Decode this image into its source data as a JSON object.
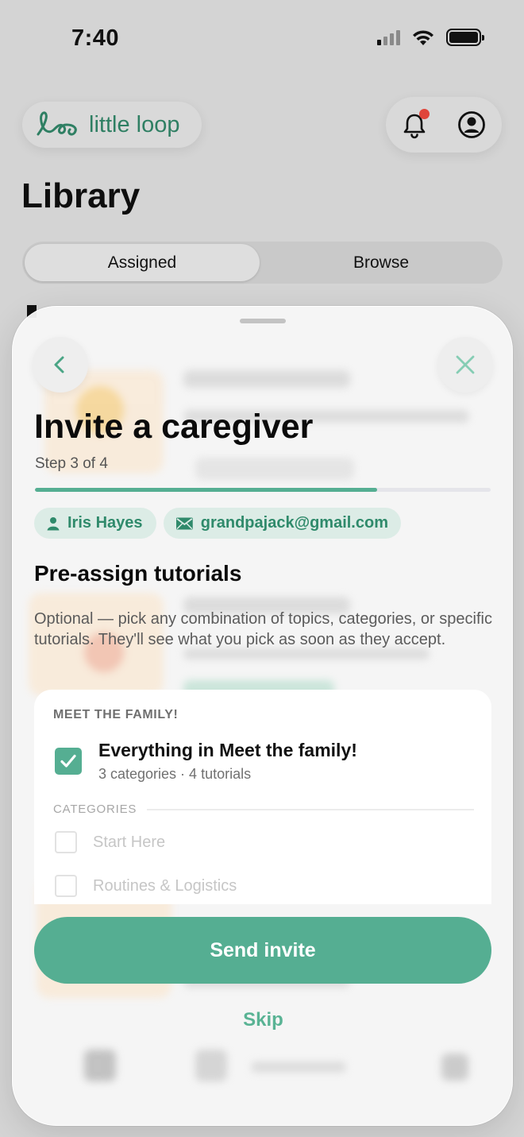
{
  "status_bar": {
    "time": "7:40"
  },
  "header": {
    "brand_name": "little loop"
  },
  "library": {
    "title": "Library",
    "tabs": [
      {
        "label": "Assigned",
        "active": true
      },
      {
        "label": "Browse",
        "active": false
      }
    ]
  },
  "sheet": {
    "title": "Invite a caregiver",
    "step": "Step 3 of 4",
    "progress": 0.75,
    "chips": {
      "name": "Iris Hayes",
      "email": "grandpajack@gmail.com"
    },
    "section_title": "Pre-assign tutorials",
    "description": "Optional — pick any combination of topics, categories, or specific tutorials. They'll see what you pick as soon as they accept.",
    "topic_card": {
      "eyebrow": "MEET THE FAMILY!",
      "everything_label": "Everything in Meet the family!",
      "everything_sub": "3 categories · 4 tutorials",
      "everything_checked": true,
      "categories_label": "CATEGORIES",
      "categories": [
        {
          "label": "Start Here",
          "checked": false
        },
        {
          "label": "Routines & Logistics",
          "checked": false
        }
      ]
    },
    "primary_button": "Send invite",
    "secondary_button": "Skip"
  },
  "colors": {
    "accent": "#55ae92",
    "brand": "#2f7f63",
    "notification": "#e0453a"
  },
  "icons": [
    "loop-logo-icon",
    "bell-icon",
    "profile-icon",
    "back-chevron-icon",
    "close-icon",
    "person-icon",
    "mail-icon",
    "check-icon"
  ]
}
